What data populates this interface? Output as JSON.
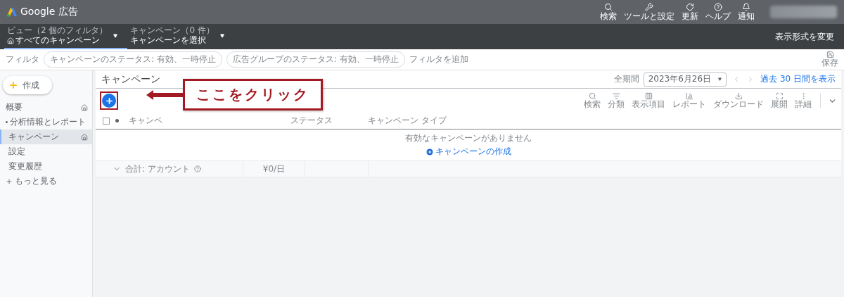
{
  "app_bar": {
    "title": "Google 広告",
    "actions": [
      {
        "kind": "search",
        "label": "検索"
      },
      {
        "kind": "tools",
        "label": "ツールと設定"
      },
      {
        "kind": "refresh",
        "label": "更新"
      },
      {
        "kind": "help",
        "label": "ヘルプ"
      },
      {
        "kind": "bell",
        "label": "通知"
      }
    ]
  },
  "nav_bar": {
    "pickers": [
      {
        "caption": "ビュー（2 個のフィルタ）",
        "value": "すべてのキャンペーン",
        "home": true,
        "selected": true
      },
      {
        "caption": "キャンペーン（0 件）",
        "value": "キャンペーンを選択",
        "home": false,
        "selected": false
      }
    ],
    "display_link": "表示形式を変更"
  },
  "filter_bar": {
    "label": "フィルタ",
    "chips": [
      "キャンペーンのステータス: 有効、一時停止",
      "広告グループのステータス: 有効、一時停止"
    ],
    "add_link": "フィルタを追加",
    "save": "保存"
  },
  "sidebar": {
    "create": "作成",
    "items": [
      {
        "kind": "page",
        "label": "概要",
        "home": true,
        "selected": false
      },
      {
        "kind": "section",
        "label": "分析情報とレポート",
        "home": false,
        "selected": false
      },
      {
        "kind": "page",
        "label": "キャンペーン",
        "home": true,
        "selected": true
      },
      {
        "kind": "page",
        "label": "設定",
        "home": false,
        "selected": false
      },
      {
        "kind": "page",
        "label": "変更履歴",
        "home": false,
        "selected": false
      },
      {
        "kind": "more",
        "label": "もっと見る",
        "home": false,
        "selected": false
      }
    ]
  },
  "main": {
    "title": "キャンペーン",
    "date_range": {
      "label": "全期間",
      "value": "2023年6月26日",
      "link": "過去 30 日間を表示"
    },
    "toolbar": [
      {
        "kind": "search",
        "label": "検索"
      },
      {
        "kind": "segment",
        "label": "分類"
      },
      {
        "kind": "columns",
        "label": "表示項目"
      },
      {
        "kind": "report",
        "label": "レポート"
      },
      {
        "kind": "download",
        "label": "ダウンロード"
      },
      {
        "kind": "expand",
        "label": "展開"
      },
      {
        "kind": "more",
        "label": "詳細"
      }
    ],
    "table": {
      "select_all": {
        "checked": false
      },
      "columns": [
        "キャンペ",
        "ステータス",
        "キャンペーン タイプ"
      ],
      "empty_message": "有効なキャンペーンがありません",
      "create_link": "キャンペーンの作成",
      "total_row": {
        "label": "合計: アカウント",
        "budget": "¥0/日"
      }
    }
  },
  "annotation": {
    "text": "ここをクリック"
  }
}
